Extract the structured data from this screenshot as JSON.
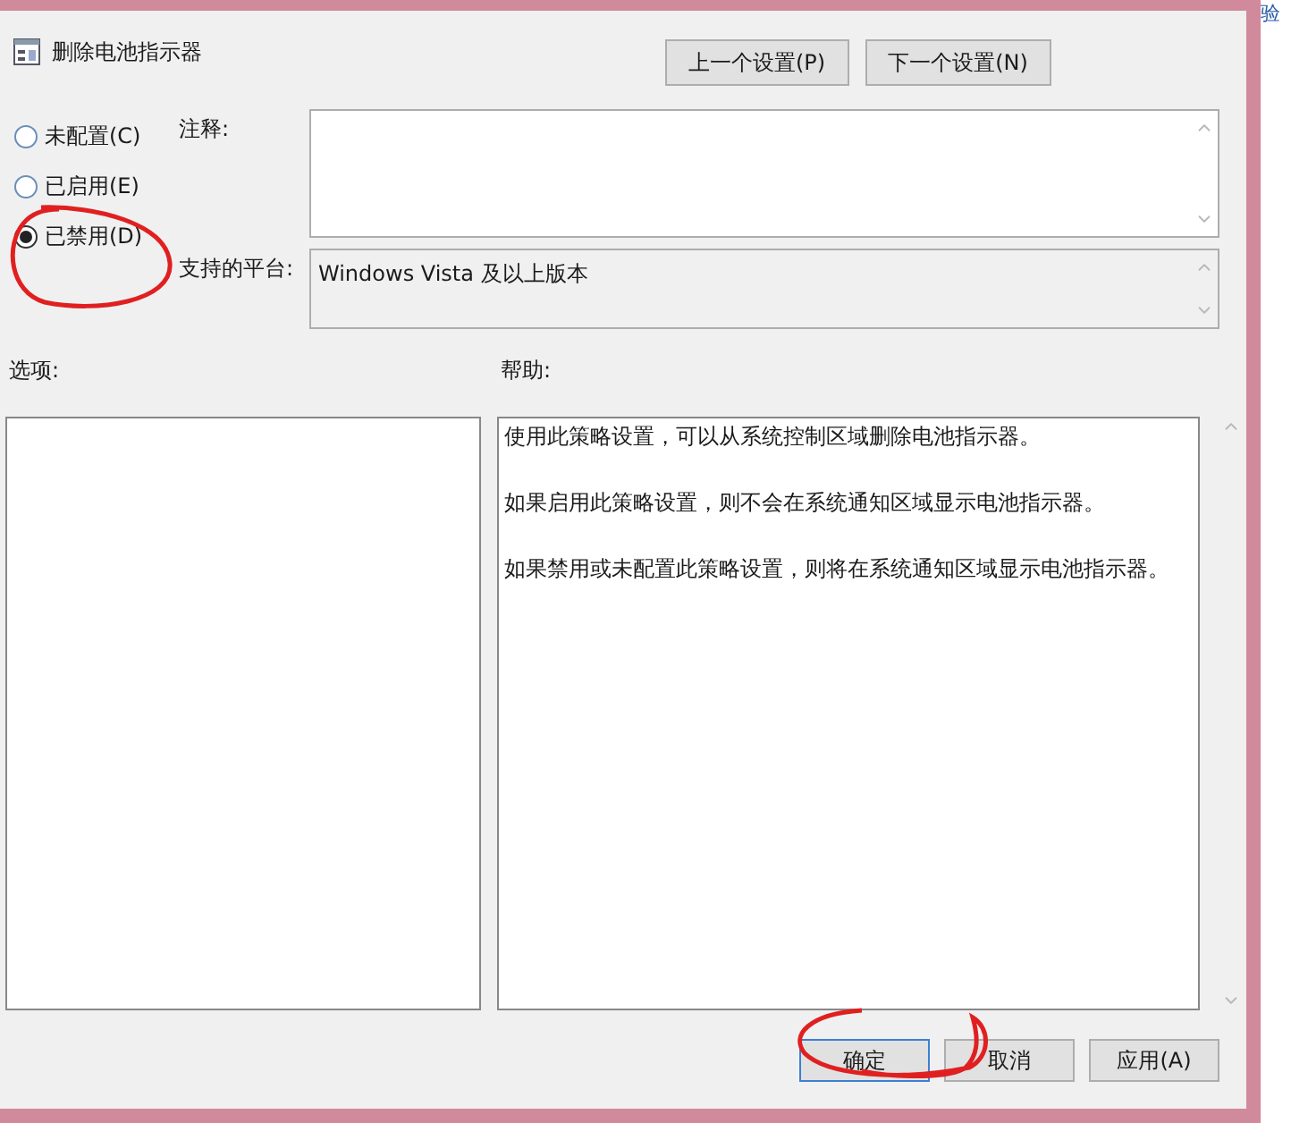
{
  "window": {
    "title": "删除电池指示器"
  },
  "nav_buttons": [
    "上一个设置(P)",
    "下一个设置(N)"
  ],
  "radios": [
    {
      "label": "未配置(C)",
      "selected": false
    },
    {
      "label": "已启用(E)",
      "selected": false
    },
    {
      "label": "已禁用(D)",
      "selected": true
    }
  ],
  "comment": {
    "label": "注释:"
  },
  "platform": {
    "label": "支持的平台:",
    "value": "Windows Vista 及以上版本"
  },
  "options": {
    "label": "选项:"
  },
  "help": {
    "label": "帮助:",
    "paragraphs": [
      "使用此策略设置，可以从系统控制区域删除电池指示器。",
      "如果启用此策略设置，则不会在系统通知区域显示电池指示器。",
      "如果禁用或未配置此策略设置，则将在系统通知区域显示电池指示器。"
    ]
  },
  "buttons": [
    "确定",
    "取消",
    "应用(A)"
  ],
  "background_window": {
    "text": "验"
  }
}
